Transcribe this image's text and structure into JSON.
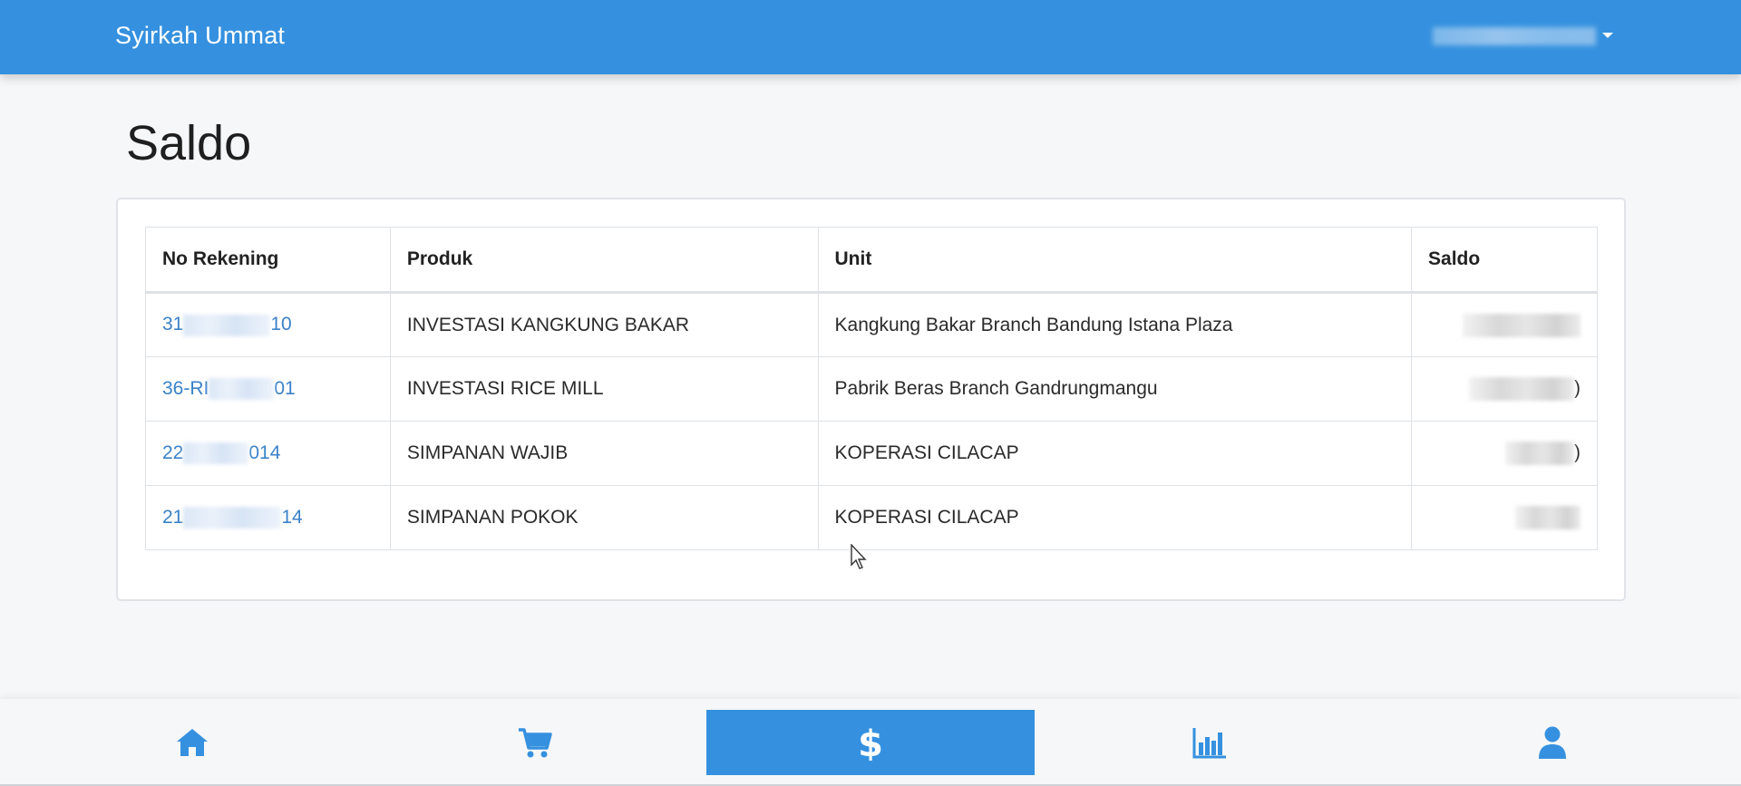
{
  "navbar": {
    "brand": "Syirkah Ummat",
    "user_menu_icon": "chevron-down-icon"
  },
  "page": {
    "title": "Saldo"
  },
  "table": {
    "headers": [
      "No Rekening",
      "Produk",
      "Unit",
      "Saldo"
    ],
    "rows": [
      {
        "no_rekening_prefix": "31",
        "no_rekening_suffix": "10",
        "produk": "INVESTASI KANGKUNG BAKAR",
        "unit": "Kangkung Bakar Branch Bandung Istana Plaza",
        "saldo_tail": ""
      },
      {
        "no_rekening_prefix": "36-RI",
        "no_rekening_suffix": "01",
        "produk": "INVESTASI RICE MILL",
        "unit": "Pabrik Beras Branch Gandrungmangu",
        "saldo_tail": ")"
      },
      {
        "no_rekening_prefix": "22",
        "no_rekening_suffix": "014",
        "produk": "SIMPANAN WAJIB",
        "unit": "KOPERASI CILACAP",
        "saldo_tail": ")"
      },
      {
        "no_rekening_prefix": "21",
        "no_rekening_suffix": "14",
        "produk": "SIMPANAN POKOK",
        "unit": "KOPERASI CILACAP",
        "saldo_tail": ""
      }
    ]
  },
  "bottom_nav": {
    "items": [
      {
        "icon": "home-icon",
        "active": false
      },
      {
        "icon": "cart-icon",
        "active": false
      },
      {
        "icon": "dollar-icon",
        "active": true
      },
      {
        "icon": "bar-chart-icon",
        "active": false
      },
      {
        "icon": "user-icon",
        "active": false
      }
    ]
  },
  "colors": {
    "primary": "#3591df",
    "link": "#3b82c8",
    "background": "#f6f7f9"
  }
}
